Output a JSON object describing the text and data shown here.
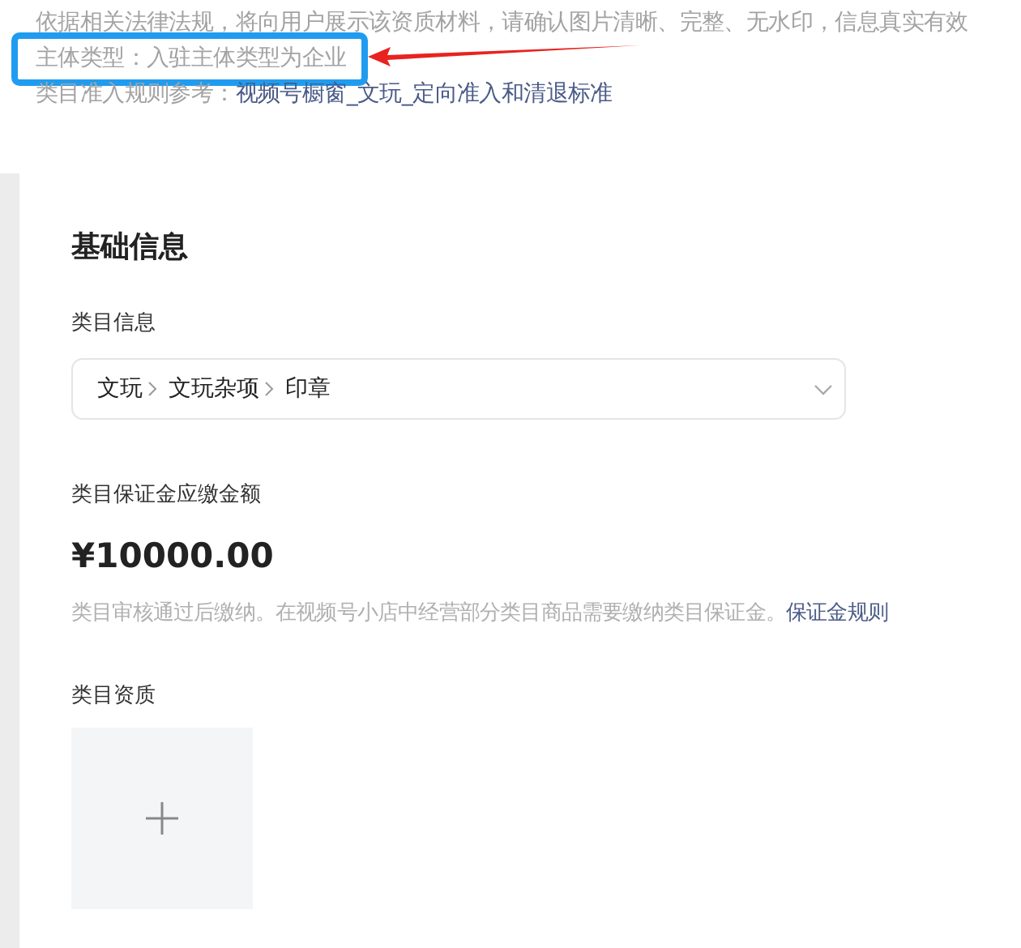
{
  "notice": {
    "lines": [
      {
        "kind": "text",
        "text": "依据相关法律法规，将向用户展示该资质材料，请确认图片清晰、完整、无水印，信息真实有效"
      },
      {
        "kind": "text",
        "text": "主体类型：入驻主体类型为企业",
        "highlighted": true
      },
      {
        "kind": "link",
        "label": "类目准入规则参考：",
        "link": "视频号橱窗_文玩_定向准入和清退标准"
      }
    ]
  },
  "section": {
    "title": "基础信息",
    "category": {
      "label": "类目信息",
      "path": [
        "文玩",
        "文玩杂项",
        "印章"
      ]
    },
    "deposit": {
      "label": "类目保证金应缴金额",
      "amount": "¥10000.00",
      "note": "类目审核通过后缴纳。在视频号小店中经营部分类目商品需要缴纳类目保证金。",
      "link": "保证金规则"
    },
    "qualification": {
      "label": "类目资质"
    }
  }
}
